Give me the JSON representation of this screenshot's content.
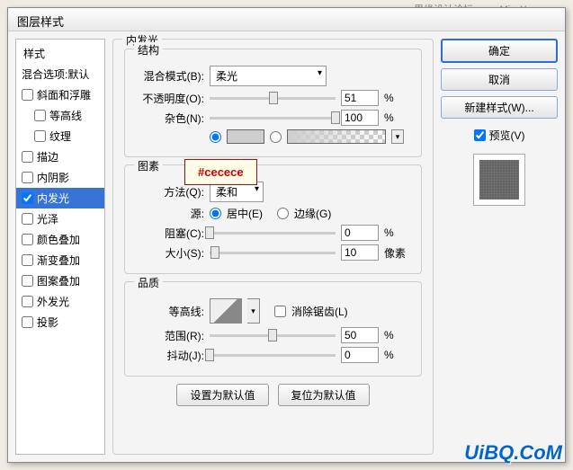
{
  "watermarks": {
    "top": "思缘设计论坛  www.MissYuan.com",
    "bottom": "UiBQ.CoM"
  },
  "window": {
    "title": "图层样式"
  },
  "sidebar": {
    "header": "样式",
    "blend_header": "混合选项:默认",
    "items": [
      {
        "label": "斜面和浮雕",
        "checked": false
      },
      {
        "label": "等高线",
        "checked": false,
        "indent": true
      },
      {
        "label": "纹理",
        "checked": false,
        "indent": true
      },
      {
        "label": "描边",
        "checked": false
      },
      {
        "label": "内阴影",
        "checked": false
      },
      {
        "label": "内发光",
        "checked": true,
        "selected": true
      },
      {
        "label": "光泽",
        "checked": false
      },
      {
        "label": "颜色叠加",
        "checked": false
      },
      {
        "label": "渐变叠加",
        "checked": false
      },
      {
        "label": "图案叠加",
        "checked": false
      },
      {
        "label": "外发光",
        "checked": false
      },
      {
        "label": "投影",
        "checked": false
      }
    ]
  },
  "main": {
    "panel_title": "内发光",
    "structure": {
      "title": "结构",
      "blend_mode_label": "混合模式(B):",
      "blend_mode_value": "柔光",
      "opacity_label": "不透明度(O):",
      "opacity_value": "51",
      "opacity_unit": "%",
      "noise_label": "杂色(N):",
      "noise_value": "100",
      "noise_unit": "%",
      "color_hex": "#cecece"
    },
    "elements": {
      "title": "图素",
      "technique_label": "方法(Q):",
      "technique_value": "柔和",
      "source_label": "源:",
      "source_center": "居中(E)",
      "source_edge": "边缘(G)",
      "choke_label": "阻塞(C):",
      "choke_value": "0",
      "choke_unit": "%",
      "size_label": "大小(S):",
      "size_value": "10",
      "size_unit": "像素"
    },
    "quality": {
      "title": "品质",
      "contour_label": "等高线:",
      "antialias_label": "消除锯齿(L)",
      "range_label": "范围(R):",
      "range_value": "50",
      "range_unit": "%",
      "jitter_label": "抖动(J):",
      "jitter_value": "0",
      "jitter_unit": "%"
    },
    "buttons": {
      "default": "设置为默认值",
      "reset": "复位为默认值"
    }
  },
  "right": {
    "ok": "确定",
    "cancel": "取消",
    "new_style": "新建样式(W)...",
    "preview_label": "预览(V)"
  },
  "callout": "#cecece"
}
